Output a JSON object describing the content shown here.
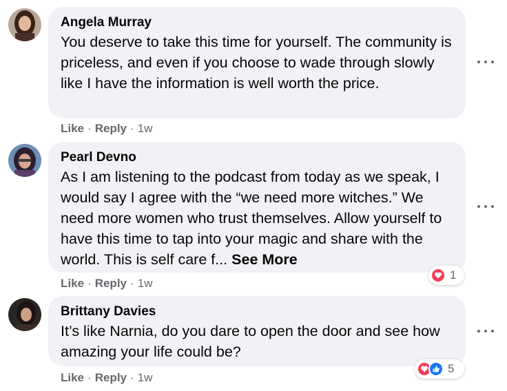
{
  "comments": [
    {
      "author": "Angela Murray",
      "text": "You deserve to take this time for yourself. The community is priceless, and even if you choose to wade through slowly like I have the information is well worth the price.",
      "see_more": "",
      "like": "Like",
      "reply": "Reply",
      "time": "1w",
      "reaction_count": ""
    },
    {
      "author": "Pearl Devno",
      "text": "As I am listening to the podcast from today as we speak, I would say I agree with the “we need more witches.” We need more women who trust themselves. Allow yourself to have this time to tap into your magic and share with the world. This is self care f...",
      "see_more": "See More",
      "like": "Like",
      "reply": "Reply",
      "time": "1w",
      "reaction_count": "1",
      "reactions": [
        "love-icon"
      ]
    },
    {
      "author": "Brittany Davies",
      "text": "It’s like Narnia, do you dare to open the door and see how amazing your life could be?",
      "see_more": "",
      "like": "Like",
      "reply": "Reply",
      "time": "1w",
      "reaction_count": "5",
      "reactions": [
        "love-icon",
        "like-icon"
      ]
    }
  ],
  "separator": "·",
  "colors": {
    "bubble": "#f0f2f5",
    "secondary_text": "#65676b",
    "love": "#f33e58",
    "like": "#1877f2"
  }
}
